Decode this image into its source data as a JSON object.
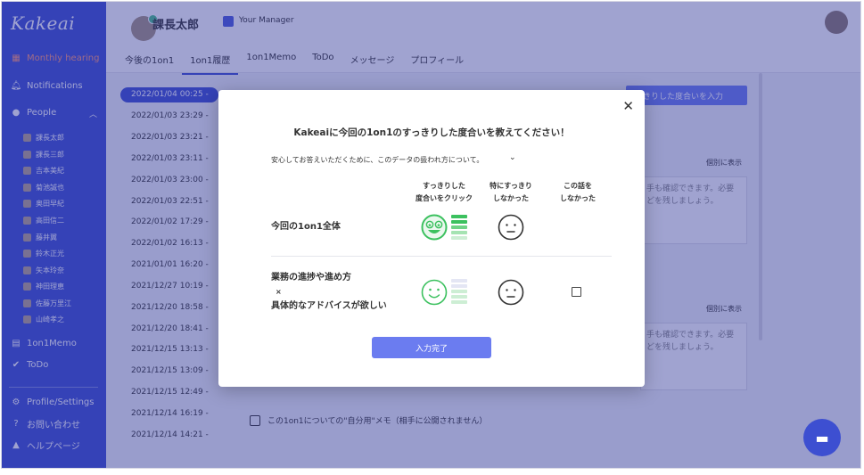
{
  "app": {
    "logo": "Kakeai"
  },
  "sidebar": {
    "monthly_hearing": "Monthly hearing",
    "notifications": "Notifications",
    "people": "People",
    "people_list": [
      "課長太郎",
      "課長三郎",
      "吉本美紀",
      "菊池誠也",
      "奥田早紀",
      "高田信二",
      "藤井翼",
      "鈴木正光",
      "矢本玲奈",
      "神田理恵",
      "佐藤万里江",
      "山崎孝之"
    ],
    "oneononememo": "1on1Memo",
    "todo": "ToDo",
    "profile_settings": "Profile/Settings",
    "contact": "お問い合わせ",
    "help": "ヘルプページ"
  },
  "header": {
    "user_name": "課長太郎",
    "manager_label": "Your Manager",
    "tabs": [
      "今後の1on1",
      "1on1履歴",
      "1on1Memo",
      "ToDo",
      "メッセージ",
      "プロフィール"
    ]
  },
  "dates": [
    "2022/01/04 00:25 -",
    "2022/01/03 23:29 -",
    "2022/01/03 23:21 -",
    "2022/01/03 23:11 -",
    "2022/01/03 23:00 -",
    "2022/01/03 22:51 -",
    "2022/01/02 17:29 -",
    "2022/01/02 16:13 -",
    "2021/01/01 16:20 -",
    "2021/12/27 10:19 -",
    "2021/12/20 18:58 -",
    "2021/12/20 18:41 -",
    "2021/12/15 13:13 -",
    "2021/12/15 13:09 -",
    "2021/12/15 12:49 -",
    "2021/12/14 16:19 -",
    "2021/12/14 14:21 -"
  ],
  "content": {
    "input_button": "っきりした度合いを入力",
    "show_link_1": "個別に表示",
    "show_link_2": "個別に表示",
    "bg_text_1a": "手も確認できます。必要",
    "bg_text_1b": "どを残しましょう。",
    "bg_text_2a": "手も確認できます。必要",
    "bg_text_2b": "どを残しましょう。",
    "memo_line": "この1on1についての\"自分用\"メモ（相手に公開されません）"
  },
  "modal": {
    "title": "Kakeaiに今回の1on1のすっきりした度合いを教えてください！",
    "note": "安心してお答えいただくために、このデータの扱われ方について。",
    "col1_line1": "すっきりした",
    "col1_line2": "度合いをクリック",
    "col2_line1": "特にすっきり",
    "col2_line2": "しなかった",
    "col3_line1": "この話を",
    "col3_line2": "しなかった",
    "row1_label": "今回の1on1全体",
    "row2_line1": "業務の進捗や進め方",
    "row2_line2": "×",
    "row2_line3": "具体的なアドバイスが欲しい",
    "submit": "入力完了"
  },
  "colors": {
    "sidebar": "#3d4fd1",
    "accent": "#6b7cf0",
    "green": "#3cc15f"
  }
}
